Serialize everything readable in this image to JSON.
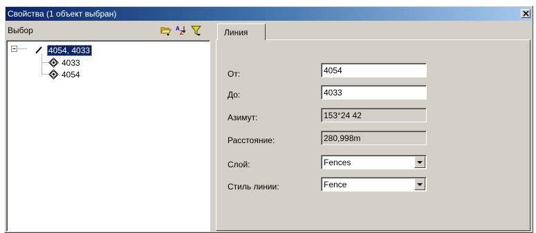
{
  "window": {
    "title": "Свойства (1 объект выбран)"
  },
  "left_pane": {
    "title": "Выбор",
    "toolbar_icons": [
      "open-folder-icon",
      "sort-az-icon",
      "filter-icon"
    ],
    "tree": {
      "root": {
        "label": "4054, 4033",
        "icon": "line-icon",
        "expanded": true
      },
      "children": [
        {
          "label": "4033",
          "icon": "point-icon"
        },
        {
          "label": "4054",
          "icon": "point-icon"
        }
      ]
    }
  },
  "tabs": [
    {
      "label": "Линия",
      "active": true
    }
  ],
  "form": {
    "from": {
      "label": "От:",
      "value": "4054"
    },
    "to": {
      "label": "До:",
      "value": "4033"
    },
    "azimuth": {
      "label": "Азимут:",
      "value": "153°24 42"
    },
    "distance": {
      "label": "Расстояние:",
      "value": "280,998m"
    },
    "layer": {
      "label": "Слой:",
      "value": "Fences"
    },
    "line_style": {
      "label": "Стиль линии:",
      "value": "Fence"
    }
  },
  "colors": {
    "titlebar_start": "#0a246a",
    "titlebar_end": "#a6caf0",
    "face": "#d4d0c8",
    "selection": "#0a246a"
  }
}
